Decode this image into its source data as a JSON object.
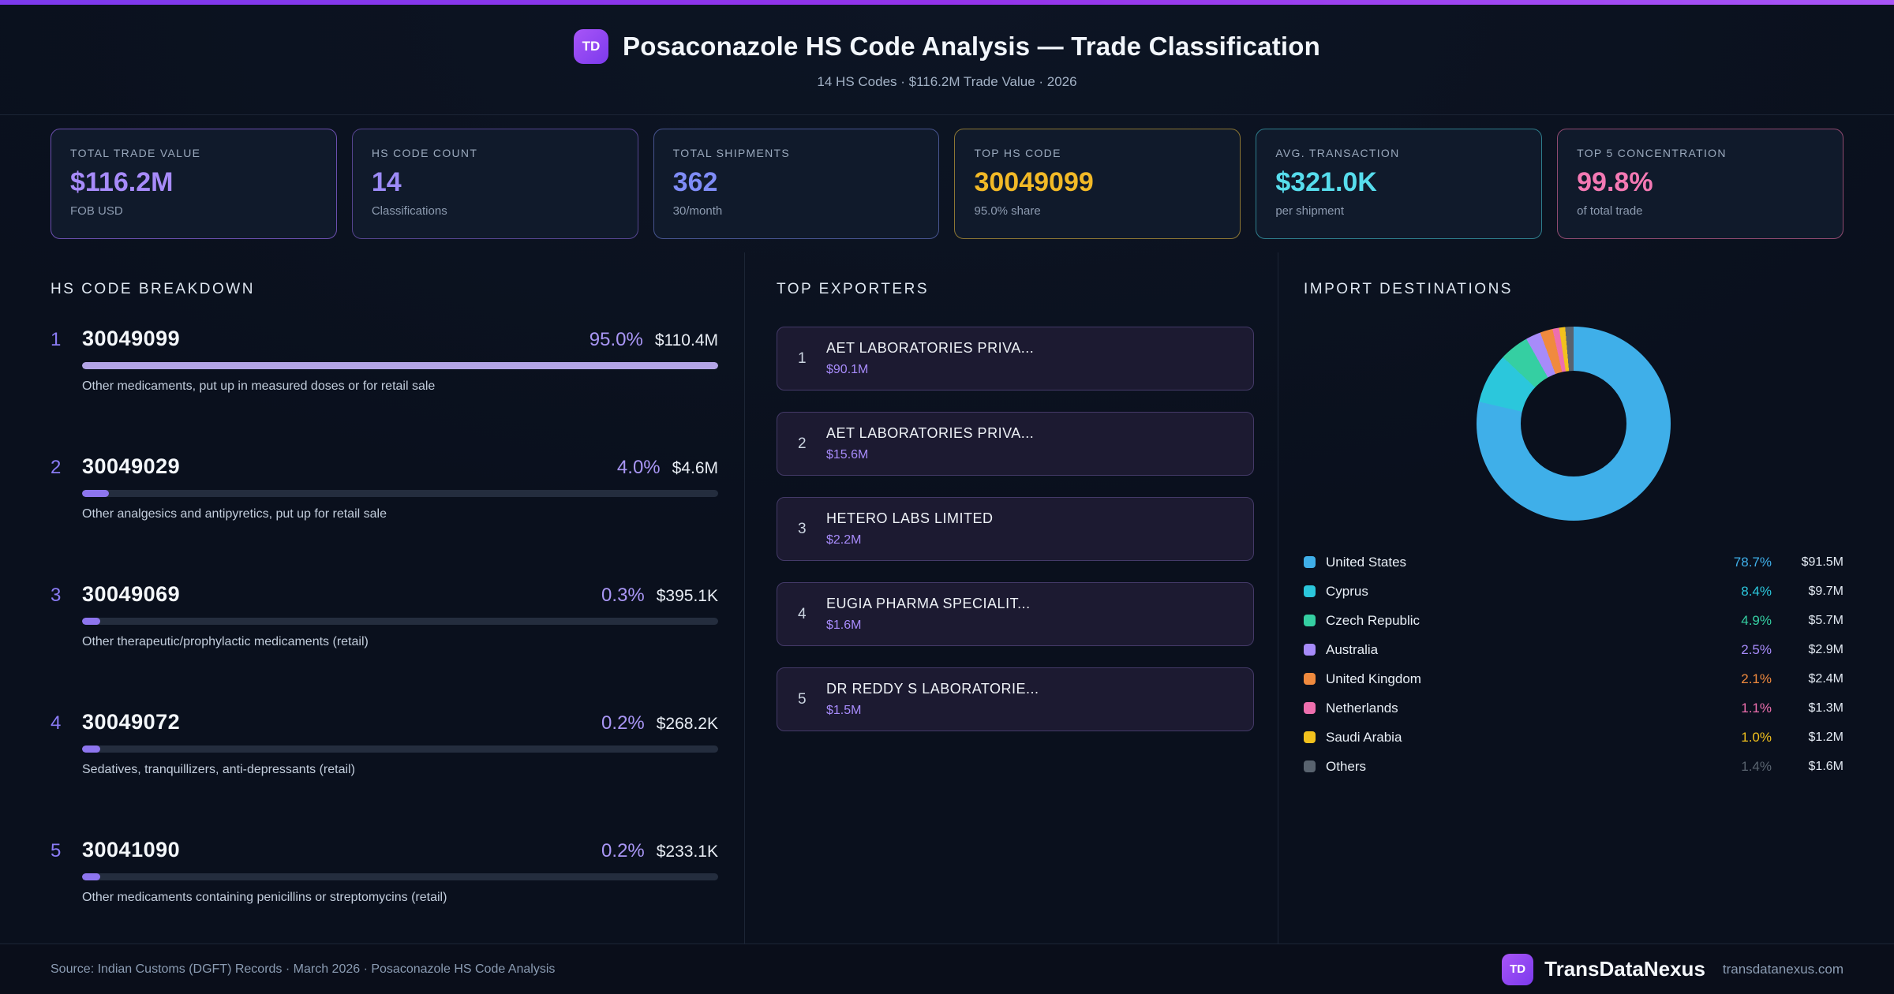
{
  "header": {
    "logo": "TD",
    "title": "Posaconazole HS Code Analysis — Trade Classification",
    "subtitle": "14 HS Codes · $116.2M Trade Value · 2026"
  },
  "stats": [
    {
      "label": "TOTAL TRADE VALUE",
      "value": "$116.2M",
      "sub": "FOB USD",
      "value_color": "#a78bfa",
      "border_color": "#6b4fae"
    },
    {
      "label": "HS CODE COUNT",
      "value": "14",
      "sub": "Classifications",
      "value_color": "#9d8bf7",
      "border_color": "#55448f"
    },
    {
      "label": "TOTAL SHIPMENTS",
      "value": "362",
      "sub": "30/month",
      "value_color": "#7f8cf7",
      "border_color": "#47548f"
    },
    {
      "label": "TOP HS CODE",
      "value": "30049099",
      "sub": "95.0% share",
      "value_color": "#f2b927",
      "border_color": "#8c7634"
    },
    {
      "label": "AVG. TRANSACTION",
      "value": "$321.0K",
      "sub": "per shipment",
      "value_color": "#57dded",
      "border_color": "#2e7d8c"
    },
    {
      "label": "TOP 5 CONCENTRATION",
      "value": "99.8%",
      "sub": "of total trade",
      "value_color": "#f479b4",
      "border_color": "#8f4a70"
    }
  ],
  "sections": {
    "breakdown_title": "HS CODE BREAKDOWN",
    "exporters_title": "TOP EXPORTERS",
    "destinations_title": "IMPORT DESTINATIONS"
  },
  "exporters": [
    {
      "rank": "1",
      "name": "AET LABORATORIES PRIVA...",
      "value": "$90.1M"
    },
    {
      "rank": "2",
      "name": "AET LABORATORIES PRIVA...",
      "value": "$15.6M"
    },
    {
      "rank": "3",
      "name": "HETERO LABS LIMITED",
      "value": "$2.2M"
    },
    {
      "rank": "4",
      "name": "EUGIA PHARMA SPECIALIT...",
      "value": "$1.6M"
    },
    {
      "rank": "5",
      "name": "DR REDDY S LABORATORIE...",
      "value": "$1.5M"
    }
  ],
  "chart_data": [
    {
      "type": "bar",
      "title": "HS CODE BREAKDOWN",
      "categories": [
        "30049099",
        "30049029",
        "30049069",
        "30049072",
        "30041090"
      ],
      "values": [
        95.0,
        4.0,
        0.3,
        0.2,
        0.2
      ],
      "pct_labels": [
        "95.0%",
        "4.0%",
        "0.3%",
        "0.2%",
        "0.2%"
      ],
      "value_labels": [
        "$110.4M",
        "$4.6M",
        "$395.1K",
        "$268.2K",
        "$233.1K"
      ],
      "descriptions": [
        "Other medicaments, put up in measured doses or for retail sale",
        "Other analgesics and antipyretics, put up for retail sale",
        "Other therapeutic/prophylactic medicaments (retail)",
        "Sedatives, tranquillizers, anti-depressants (retail)",
        "Other medicaments containing penicillins or streptomycins (retail)"
      ],
      "bar_colors": [
        "#b3a4e6",
        "#8d75ee",
        "#8d75ee",
        "#8d75ee",
        "#8d75ee"
      ],
      "track_color": "#242d3e"
    },
    {
      "type": "pie",
      "donut": true,
      "title": "IMPORT DESTINATIONS",
      "categories": [
        "United States",
        "Cyprus",
        "Czech Republic",
        "Australia",
        "United Kingdom",
        "Netherlands",
        "Saudi Arabia",
        "Others"
      ],
      "values": [
        78.7,
        8.4,
        4.9,
        2.5,
        2.1,
        1.1,
        1.0,
        1.4
      ],
      "pct_labels": [
        "78.7%",
        "8.4%",
        "4.9%",
        "2.5%",
        "2.1%",
        "1.1%",
        "1.0%",
        "1.4%"
      ],
      "value_labels": [
        "$91.5M",
        "$9.7M",
        "$5.7M",
        "$2.9M",
        "$2.4M",
        "$1.3M",
        "$1.2M",
        "$1.6M"
      ],
      "colors": [
        "#3fafe9",
        "#2bc7dc",
        "#35cfa2",
        "#a78bfa",
        "#f08a3e",
        "#ee6fae",
        "#f2c11d",
        "#59636f"
      ],
      "start_angle_deg": 0,
      "direction": "clockwise",
      "legend_position": "below"
    }
  ],
  "footer": {
    "source": "Source: Indian Customs (DGFT) Records · March 2026 · Posaconazole HS Code Analysis",
    "logo": "TD",
    "brand": "TransDataNexus",
    "domain": "transdatanexus.com"
  }
}
